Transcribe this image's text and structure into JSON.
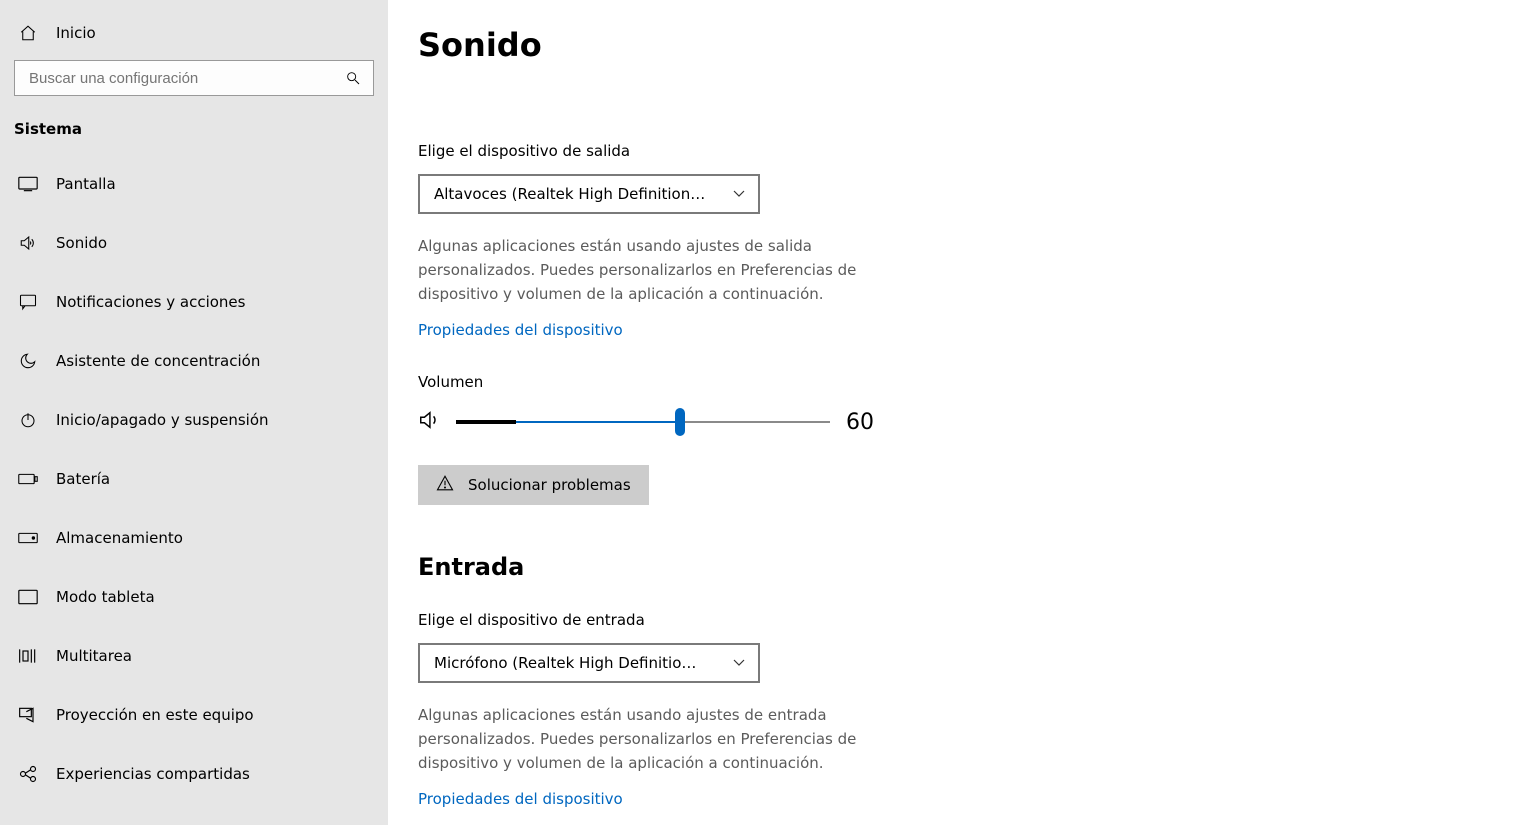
{
  "sidebar": {
    "home": "Inicio",
    "search_placeholder": "Buscar una configuración",
    "category": "Sistema",
    "items": [
      {
        "label": "Pantalla",
        "icon": "display"
      },
      {
        "label": "Sonido",
        "icon": "sound"
      },
      {
        "label": "Notificaciones y acciones",
        "icon": "notifications"
      },
      {
        "label": "Asistente de concentración",
        "icon": "moon"
      },
      {
        "label": "Inicio/apagado y suspensión",
        "icon": "power"
      },
      {
        "label": "Batería",
        "icon": "battery"
      },
      {
        "label": "Almacenamiento",
        "icon": "storage"
      },
      {
        "label": "Modo tableta",
        "icon": "tablet"
      },
      {
        "label": "Multitarea",
        "icon": "multitask"
      },
      {
        "label": "Proyección en este equipo",
        "icon": "project"
      },
      {
        "label": "Experiencias compartidas",
        "icon": "shared"
      }
    ]
  },
  "main": {
    "title": "Sonido",
    "output_label": "Elige el dispositivo de salida",
    "output_device": "Altavoces (Realtek High Definition…",
    "output_desc": "Algunas aplicaciones están usando ajustes de salida personalizados. Puedes personalizarlos en Preferencias de dispositivo y volumen de la aplicación a continuación.",
    "device_props_link": "Propiedades del dispositivo",
    "volume_label": "Volumen",
    "volume_value": "60",
    "troubleshoot": "Solucionar problemas",
    "input_heading": "Entrada",
    "input_label": "Elige el dispositivo de entrada",
    "input_device": "Micrófono (Realtek High Definitio…",
    "input_desc": "Algunas aplicaciones están usando ajustes de entrada personalizados. Puedes personalizarlos en Preferencias de dispositivo y volumen de la aplicación a continuación.",
    "input_props_link": "Propiedades del dispositivo"
  }
}
